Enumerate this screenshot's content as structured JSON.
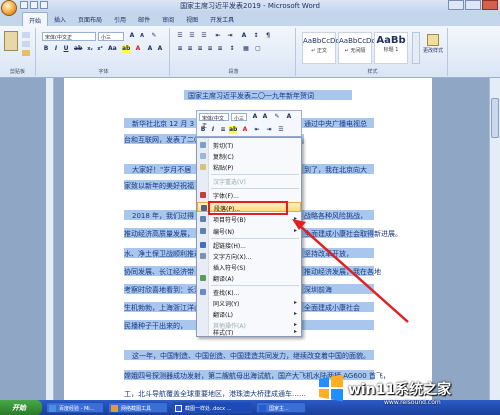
{
  "window": {
    "title": "国家主席习近平发表2019 - Microsoft Word"
  },
  "tabs": [
    "开始",
    "插入",
    "页面布局",
    "引用",
    "邮件",
    "审阅",
    "视图",
    "开发工具"
  ],
  "ribbon": {
    "groups": [
      "剪贴板",
      "字体",
      "段落",
      "样式"
    ],
    "font_name": "宋体(中文正",
    "font_size": "小三",
    "styles": [
      {
        "sample": "AaBbCcDc",
        "name": "↵ 正文"
      },
      {
        "sample": "AaBbCcDc",
        "name": "↵ 无间隔"
      },
      {
        "sample": "AaBb",
        "name": "标题 1"
      }
    ],
    "change_styles_label": "更改样式"
  },
  "document": {
    "title": "国家主席习近平发表二〇一九年新年贺词",
    "lines": [
      "新华社北京 12 月 3",
      "通过中央广播电视总",
      "台和互联网，发表了二〇一九年新年贺词，全文如下：",
      "大家好！\"岁月不居",
      "到了，我在北京向大",
      "家致以新年的美好祝福",
      "2018 年，我们过得",
      "战略各种风险挑战，",
      "推动经济高质量发展，",
      "全面建成小康社会取得新进展。",
      "水、净土保卫战顺利推进",
      "坚持改革开放，",
      "协同发展、长江经济带",
      "推动经济发展，我在各地",
      "考察时欣喜地看到：长江",
      "深圳前海",
      "生机勃勃，上海浙江洋山",
      "全面建成小康社会",
      "民播种子干出来的，",
      "这一年，中国制造、中国创造、中国建造共同发力，继续改变着中国的面貌。",
      "嫦娥四号探测器成功发射，第二艘航母出海试航，国产大飞机水陆两栖 AG600 首飞，",
      "工，北斗导航覆盖全球重要地区，港珠澳大桥建成通车……"
    ]
  },
  "mini_toolbar": {
    "font": "宋体(中文正",
    "size": "小三"
  },
  "context_menu": {
    "items": [
      {
        "label": "剪切(T)",
        "enabled": true
      },
      {
        "label": "复制(C)",
        "enabled": true
      },
      {
        "label": "粘贴(P)",
        "enabled": true
      },
      {
        "label": "汉字重选(V)",
        "enabled": false
      },
      {
        "label": "字体(F)...",
        "enabled": true
      },
      {
        "label": "段落(P)...",
        "enabled": true,
        "highlighted": true
      },
      {
        "label": "项目符号(B)",
        "enabled": true,
        "submenu": true
      },
      {
        "label": "编号(N)",
        "enabled": true,
        "submenu": true
      },
      {
        "label": "超链接(H)...",
        "enabled": true
      },
      {
        "label": "文字方向(X)...",
        "enabled": true
      },
      {
        "label": "插入符号(S)",
        "enabled": true
      },
      {
        "label": "翻译(A)",
        "enabled": true
      },
      {
        "label": "查找(K)...",
        "enabled": true
      },
      {
        "label": "同义词(Y)",
        "enabled": true,
        "submenu": true
      },
      {
        "label": "翻译(L)",
        "enabled": true,
        "submenu": true
      },
      {
        "label": "其他操作(A)",
        "enabled": false
      },
      {
        "label": "样式(T)",
        "enabled": true,
        "submenu": true
      }
    ]
  },
  "taskbar": {
    "start_label": "开始",
    "tasks": [
      "百度经验 - Mi...",
      "网络截图工具",
      "截图一样处..docx ...",
      "国家主..."
    ]
  },
  "watermark": {
    "brand": "win11系统之家",
    "url": "www.relsound.com"
  },
  "colors": {
    "highlight": "#e02020",
    "selection": "#a8c6ee"
  }
}
